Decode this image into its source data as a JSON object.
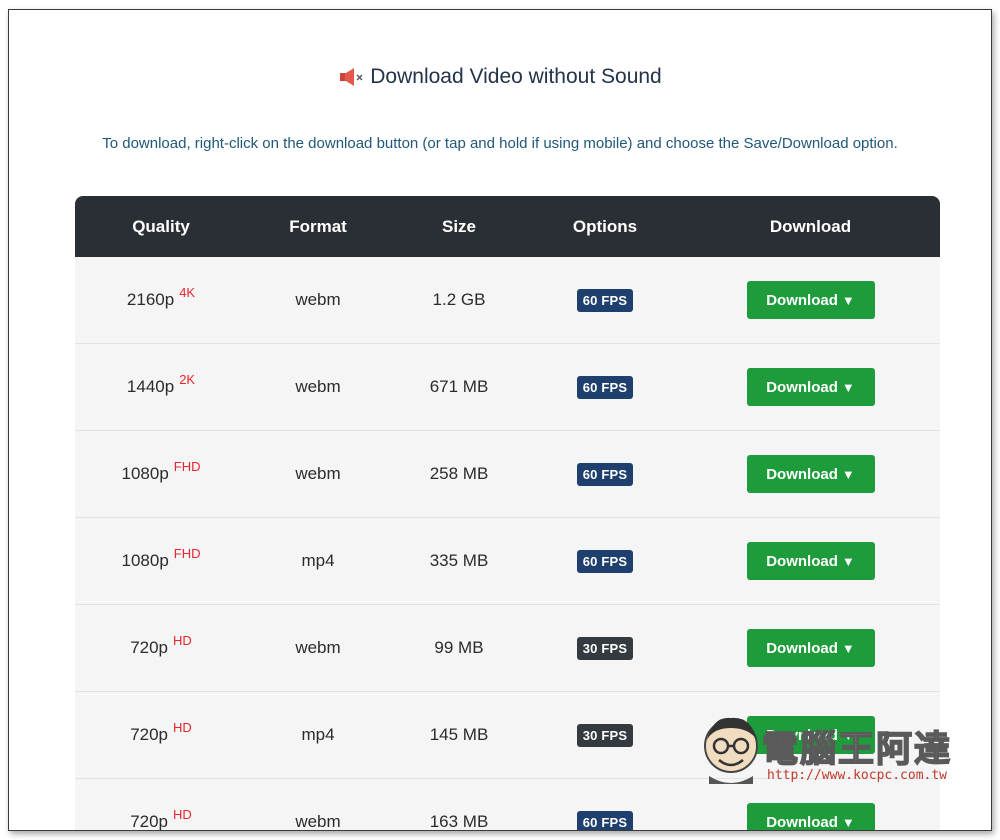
{
  "title": "Download Video without Sound",
  "icons": {
    "title_icon": "muted-speaker-icon",
    "dropdown_icon": "caret-down-icon"
  },
  "instructions": "To download, right-click on the download button (or tap and hold if using mobile) and choose the Save/Download option.",
  "table": {
    "headers": [
      "Quality",
      "Format",
      "Size",
      "Options",
      "Download"
    ],
    "rows": [
      {
        "quality": "2160p",
        "tag": "4K",
        "format": "webm",
        "size": "1.2 GB",
        "fps": "60 FPS",
        "download": "Download"
      },
      {
        "quality": "1440p",
        "tag": "2K",
        "format": "webm",
        "size": "671 MB",
        "fps": "60 FPS",
        "download": "Download"
      },
      {
        "quality": "1080p",
        "tag": "FHD",
        "format": "webm",
        "size": "258 MB",
        "fps": "60 FPS",
        "download": "Download"
      },
      {
        "quality": "1080p",
        "tag": "FHD",
        "format": "mp4",
        "size": "335 MB",
        "fps": "60 FPS",
        "download": "Download"
      },
      {
        "quality": "720p",
        "tag": "HD",
        "format": "webm",
        "size": "99 MB",
        "fps": "30 FPS",
        "download": "Download"
      },
      {
        "quality": "720p",
        "tag": "HD",
        "format": "mp4",
        "size": "145 MB",
        "fps": "30 FPS",
        "download": "Download"
      },
      {
        "quality": "720p",
        "tag": "HD",
        "format": "webm",
        "size": "163 MB",
        "fps": "60 FPS",
        "download": "Download"
      }
    ]
  },
  "colors": {
    "header_bg": "#2a2f35",
    "fps60_badge": "#1f3f6e",
    "fps30_badge": "#343a40",
    "download_button": "#1e9c3b",
    "quality_tag": "#e8262d"
  },
  "watermark": {
    "text": "電腦王阿達",
    "url": "http://www.kocpc.com.tw"
  }
}
